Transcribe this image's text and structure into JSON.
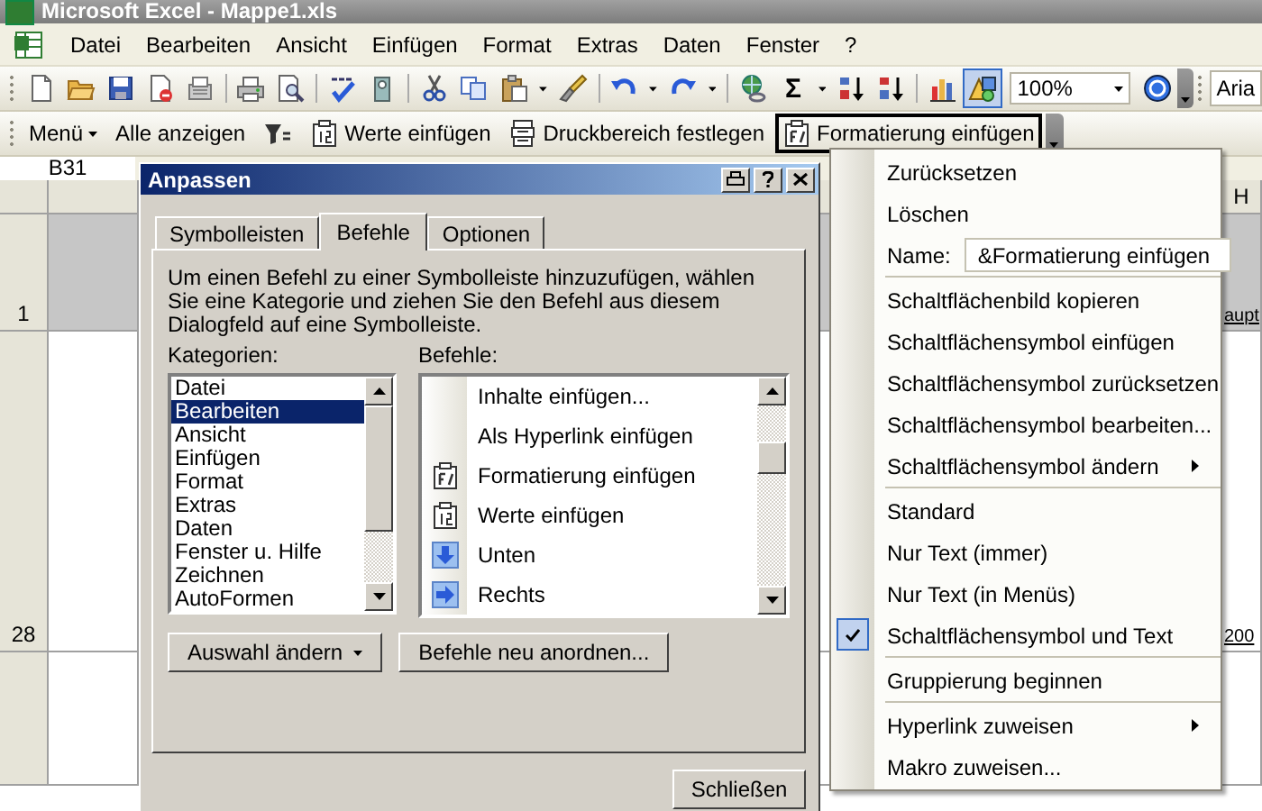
{
  "window": {
    "title": "Microsoft Excel - Mappe1.xls"
  },
  "menu_bar": [
    "Datei",
    "Bearbeiten",
    "Ansicht",
    "Einfügen",
    "Format",
    "Extras",
    "Daten",
    "Fenster",
    "?"
  ],
  "standard_toolbar": {
    "buttons": [
      {
        "kind": "new",
        "dropdown": false,
        "pressed": false
      },
      {
        "kind": "open",
        "dropdown": false,
        "pressed": false
      },
      {
        "kind": "save",
        "dropdown": false,
        "pressed": false
      },
      {
        "kind": "permission",
        "dropdown": false,
        "pressed": false
      },
      {
        "kind": "email",
        "dropdown": false,
        "pressed": false
      },
      {
        "kind": "separator"
      },
      {
        "kind": "print",
        "dropdown": false,
        "pressed": false
      },
      {
        "kind": "preview",
        "dropdown": false,
        "pressed": false
      },
      {
        "kind": "separator"
      },
      {
        "kind": "spelling",
        "dropdown": false,
        "pressed": false
      },
      {
        "kind": "research",
        "dropdown": false,
        "pressed": false
      },
      {
        "kind": "separator"
      },
      {
        "kind": "cut",
        "dropdown": false,
        "pressed": false
      },
      {
        "kind": "copy",
        "dropdown": false,
        "pressed": false
      },
      {
        "kind": "paste",
        "dropdown": true,
        "pressed": false
      },
      {
        "kind": "painter",
        "dropdown": false,
        "pressed": false
      },
      {
        "kind": "separator"
      },
      {
        "kind": "undo",
        "dropdown": true,
        "pressed": false
      },
      {
        "kind": "redo",
        "dropdown": true,
        "pressed": false
      },
      {
        "kind": "separator"
      },
      {
        "kind": "hyperlink",
        "dropdown": false,
        "pressed": false
      },
      {
        "kind": "sum",
        "glyph": "Σ",
        "dropdown": true,
        "pressed": false
      },
      {
        "kind": "sort-asc",
        "dropdown": false,
        "pressed": false
      },
      {
        "kind": "sort-desc",
        "dropdown": false,
        "pressed": false
      },
      {
        "kind": "separator"
      },
      {
        "kind": "chart",
        "dropdown": false,
        "pressed": false
      },
      {
        "kind": "drawing",
        "dropdown": false,
        "pressed": true
      },
      {
        "kind": "zoom",
        "value": "100%"
      },
      {
        "kind": "help",
        "dropdown": false,
        "pressed": false
      }
    ],
    "font": "Aria"
  },
  "custom_toolbar": {
    "items": [
      {
        "kind": "menu",
        "label": "Menü",
        "selected": false
      },
      {
        "kind": "text",
        "label": "Alle anzeigen",
        "selected": false
      },
      {
        "kind": "filter",
        "selected": false
      },
      {
        "kind": "values",
        "label": "Werte einfügen",
        "selected": false
      },
      {
        "kind": "print-area",
        "label": "Druckbereich festlegen",
        "selected": false
      },
      {
        "kind": "format-paste",
        "label": "Formatierung einfügen",
        "selected": true
      }
    ]
  },
  "sheet": {
    "name_box": "B31",
    "column_header": "H",
    "rows": [
      {
        "header": "1",
        "cell": "aupt"
      },
      {
        "header": "28",
        "cell": "200"
      }
    ]
  },
  "dialog": {
    "title": "Anpassen",
    "tabs": [
      {
        "label": "Symbolleisten",
        "selected": false
      },
      {
        "label": "Befehle",
        "selected": true
      },
      {
        "label": "Optionen",
        "selected": false
      }
    ],
    "description": "Um einen Befehl zu einer Symbolleiste hinzuzufügen, wählen Sie eine Kategorie und ziehen Sie den Befehl aus diesem Dialogfeld auf eine Symbolleiste.",
    "categories_label": "Kategorien:",
    "categories": [
      {
        "label": "Datei",
        "selected": false
      },
      {
        "label": "Bearbeiten",
        "selected": true
      },
      {
        "label": "Ansicht",
        "selected": false
      },
      {
        "label": "Einfügen",
        "selected": false
      },
      {
        "label": "Format",
        "selected": false
      },
      {
        "label": "Extras",
        "selected": false
      },
      {
        "label": "Daten",
        "selected": false
      },
      {
        "label": "Fenster u. Hilfe",
        "selected": false
      },
      {
        "label": "Zeichnen",
        "selected": false
      },
      {
        "label": "AutoFormen",
        "selected": false
      }
    ],
    "commands_label": "Befehle:",
    "commands": [
      {
        "kind": "none",
        "label": "Inhalte einfügen..."
      },
      {
        "kind": "none",
        "label": "Als Hyperlink einfügen"
      },
      {
        "kind": "format-paste",
        "label": "Formatierung einfügen"
      },
      {
        "kind": "values",
        "label": "Werte einfügen"
      },
      {
        "kind": "down",
        "label": "Unten"
      },
      {
        "kind": "right",
        "label": "Rechts"
      }
    ],
    "buttons": [
      {
        "label": "Auswahl ändern",
        "dropdown": true
      },
      {
        "label": "Befehle neu anordnen...",
        "dropdown": false
      }
    ],
    "close_button": "Schließen"
  },
  "context_menu": {
    "items": [
      {
        "kind": "command",
        "label": "Zurücksetzen",
        "separator_before": false,
        "checked": false,
        "submenu": false
      },
      {
        "kind": "command",
        "label": "Löschen",
        "separator_before": false,
        "checked": false,
        "submenu": false
      },
      {
        "kind": "name-field",
        "label": "Name:",
        "value": "&Formatierung einfügen",
        "separator_before": false,
        "checked": false,
        "submenu": false
      },
      {
        "kind": "command",
        "label": "Schaltflächenbild kopieren",
        "separator_before": true,
        "checked": false,
        "submenu": false
      },
      {
        "kind": "command",
        "label": "Schaltflächensymbol einfügen",
        "separator_before": false,
        "checked": false,
        "submenu": false
      },
      {
        "kind": "command",
        "label": "Schaltflächensymbol zurücksetzen",
        "separator_before": false,
        "checked": false,
        "submenu": false
      },
      {
        "kind": "command",
        "label": "Schaltflächensymbol bearbeiten...",
        "separator_before": false,
        "checked": false,
        "submenu": false
      },
      {
        "kind": "command",
        "label": "Schaltflächensymbol ändern",
        "separator_before": false,
        "checked": false,
        "submenu": true
      },
      {
        "kind": "command",
        "label": "Standard",
        "separator_before": true,
        "checked": false,
        "submenu": false
      },
      {
        "kind": "command",
        "label": "Nur Text (immer)",
        "separator_before": false,
        "checked": false,
        "submenu": false
      },
      {
        "kind": "command",
        "label": "Nur Text (in Menüs)",
        "separator_before": false,
        "checked": false,
        "submenu": false
      },
      {
        "kind": "command",
        "label": "Schaltflächensymbol und Text",
        "separator_before": false,
        "checked": true,
        "submenu": false
      },
      {
        "kind": "command",
        "label": "Gruppierung beginnen",
        "separator_before": true,
        "checked": false,
        "submenu": false
      },
      {
        "kind": "command",
        "label": "Hyperlink zuweisen",
        "separator_before": true,
        "checked": false,
        "submenu": true
      },
      {
        "kind": "command",
        "label": "Makro zuweisen...",
        "separator_before": false,
        "checked": false,
        "submenu": false
      }
    ]
  }
}
